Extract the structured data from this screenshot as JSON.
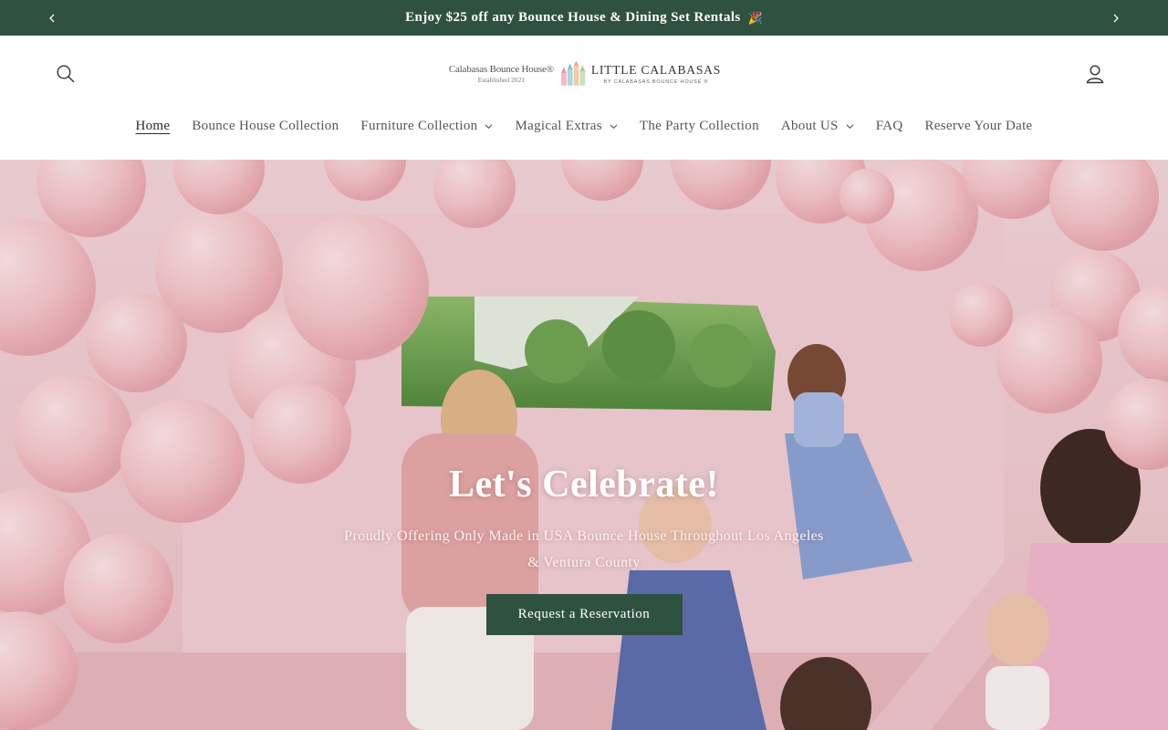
{
  "announcement": {
    "text": "Enjoy $25 off any Bounce House & Dining Set Rentals",
    "emoji": "🎉",
    "prev_icon": "chevron-left-icon",
    "next_icon": "chevron-right-icon"
  },
  "header": {
    "logo_left_line1": "Calabasas Bounce House®",
    "logo_left_line2": "Established 2021",
    "logo_right_line1": "LITTLE CALABASAS",
    "logo_right_line2": "BY CALABASAS BOUNCE HOUSE ®",
    "search_icon": "search-icon",
    "account_icon": "account-icon"
  },
  "nav": {
    "items": [
      {
        "label": "Home"
      },
      {
        "label": "Bounce House Collection"
      },
      {
        "label": "Furniture Collection"
      },
      {
        "label": "Magical Extras"
      },
      {
        "label": "The Party Collection"
      },
      {
        "label": "About US"
      },
      {
        "label": "FAQ"
      },
      {
        "label": "Reserve Your Date"
      }
    ]
  },
  "hero": {
    "title": "Let's Celebrate!",
    "subtitle": "Proudly Offering Only Made in USA Bounce House Throughout Los Angeles & Ventura County",
    "button_label": "Request a Reservation"
  },
  "colors": {
    "brand_green": "#2f5140",
    "nav_text": "#505858",
    "balloon_pink": "#f4c4c8"
  }
}
